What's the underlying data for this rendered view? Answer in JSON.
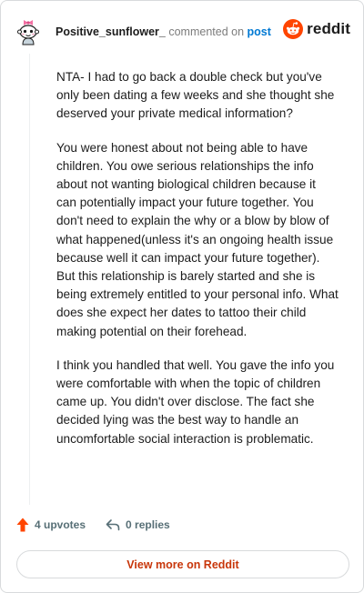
{
  "header": {
    "username": "Positive_sunflower_",
    "action_text": "commented on",
    "post_link": "post",
    "brand": "reddit"
  },
  "colors": {
    "accent": "#ff4500",
    "link": "#0079d3",
    "cta_text": "#c8360a",
    "border": "#d8dadc"
  },
  "comment": {
    "paragraphs": [
      "NTA- I had to go back a double check but you've only been dating a few weeks and she thought she deserved your private medical information?",
      "You were honest about not being able to have children. You owe serious relationships the info about not wanting biological children because it can potentially impact your future together. You don't need to explain the why or a blow by blow of what happened(unless it's an ongoing health issue because well it can impact your future together). But this relationship is barely started and she is being extremely entitled to your personal info. What does she expect her dates to tattoo their child making potential on their forehead.",
      "I think you handled that well. You gave the info you were comfortable with when the topic of children came up. You didn't over disclose. The fact she decided lying was the best way to handle an uncomfortable social interaction is problematic."
    ]
  },
  "actions": {
    "upvotes": "4 upvotes",
    "replies": "0 replies",
    "upvote_icon": "upvote-arrow-icon",
    "reply_icon": "reply-icon"
  },
  "cta": {
    "label": "View more on Reddit"
  }
}
